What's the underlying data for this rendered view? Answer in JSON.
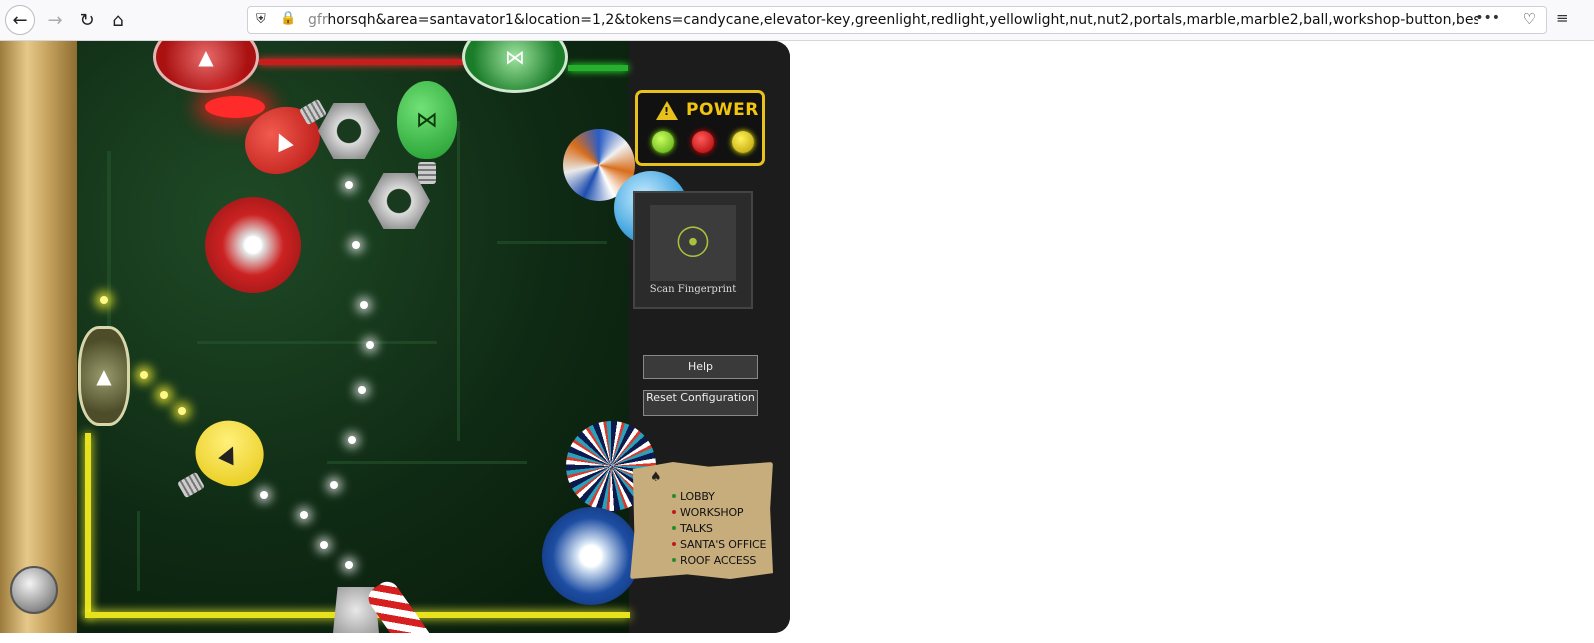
{
  "browser": {
    "url_prefix": "gfr",
    "url": "horsqh&area=santavator1&location=1,2&tokens=candycane,elevator-key,greenlight,redlight,yellowlight,nut,nut2,portals,marble,marble2,ball,workshop-button,besanta",
    "overflow_label": "•••"
  },
  "panel": {
    "power_label": "POWER",
    "scan_label": "Scan Fingerprint",
    "help_label": "Help",
    "reset_label": "Reset Configuration"
  },
  "elevator_note": {
    "floors": [
      "LOBBY",
      "WORKSHOP",
      "TALKS",
      "SANTA'S OFFICE",
      "ROOF ACCESS"
    ]
  },
  "colors": {
    "power_border": "#e8c21a",
    "light_green": "#55a50e",
    "light_red": "#aa0000",
    "light_yellow": "#b89c00"
  }
}
